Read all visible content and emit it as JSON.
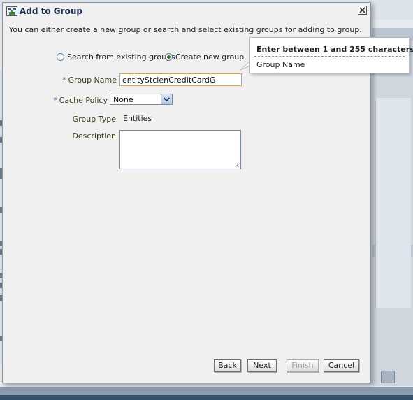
{
  "dialog": {
    "title": "Add to Group",
    "intro": "You can either create a new group or search and select existing groups for adding to group.",
    "icon": "group-add-icon",
    "close_icon": "close-icon"
  },
  "mode": {
    "options": [
      "Search from existing groups",
      "Create new group"
    ],
    "selected": "Create new group"
  },
  "form": {
    "required_marker": "*",
    "group_name": {
      "label": "Group Name",
      "value": "entityStclenCreditCardG"
    },
    "cache_policy": {
      "label": "Cache Policy",
      "value": "None"
    },
    "group_type": {
      "label": "Group Type",
      "value": "Entities"
    },
    "description": {
      "label": "Description",
      "value": ""
    }
  },
  "tooltip": {
    "title": "Enter between 1 and 255 characters.",
    "field": "Group Name"
  },
  "buttons": {
    "back": "Back",
    "next": "Next",
    "finish": "Finish",
    "cancel": "Cancel"
  },
  "colors": {
    "title_text": "#1c2f4e",
    "input_focus_border": "#e39f3c",
    "radio_selected": "#2f7d32",
    "dialog_bg": "#f0f0f0"
  }
}
